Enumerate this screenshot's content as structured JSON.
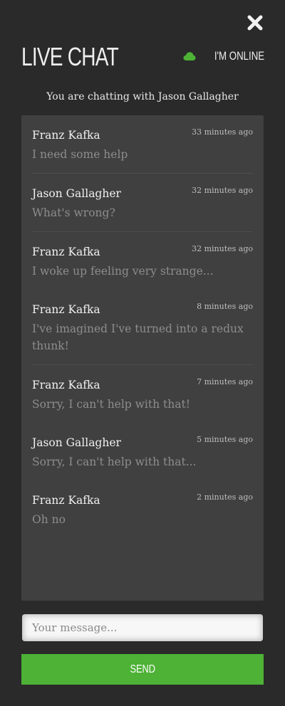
{
  "header": {
    "title": "LIVE CHAT",
    "status_label": "I'M ONLINE",
    "status_color": "#4db236"
  },
  "chat": {
    "chatting_with": "You are chatting with Jason Gallagher",
    "messages": [
      {
        "author": "Franz Kafka",
        "time": "33 minutes ago",
        "text": "I need some help"
      },
      {
        "author": "Jason Gallagher",
        "time": "32 minutes ago",
        "text": "What's wrong?"
      },
      {
        "author": "Franz Kafka",
        "time": "32 minutes ago",
        "text": "I woke up feeling very strange..."
      },
      {
        "author": "Franz Kafka",
        "time": "8 minutes ago",
        "text": "I've imagined I've turned into a redux thunk!"
      },
      {
        "author": "Franz Kafka",
        "time": "7 minutes ago",
        "text": "Sorry, I can't help with that!"
      },
      {
        "author": "Jason Gallagher",
        "time": "5 minutes ago",
        "text": "Sorry, I can't help with that..."
      },
      {
        "author": "Franz Kafka",
        "time": "2 minutes ago",
        "text": "Oh no"
      }
    ]
  },
  "composer": {
    "placeholder": "Your message...",
    "value": "",
    "send_label": "SEND",
    "send_color": "#4db236"
  },
  "icons": {
    "close": "close-icon",
    "status": "cloud-icon"
  }
}
